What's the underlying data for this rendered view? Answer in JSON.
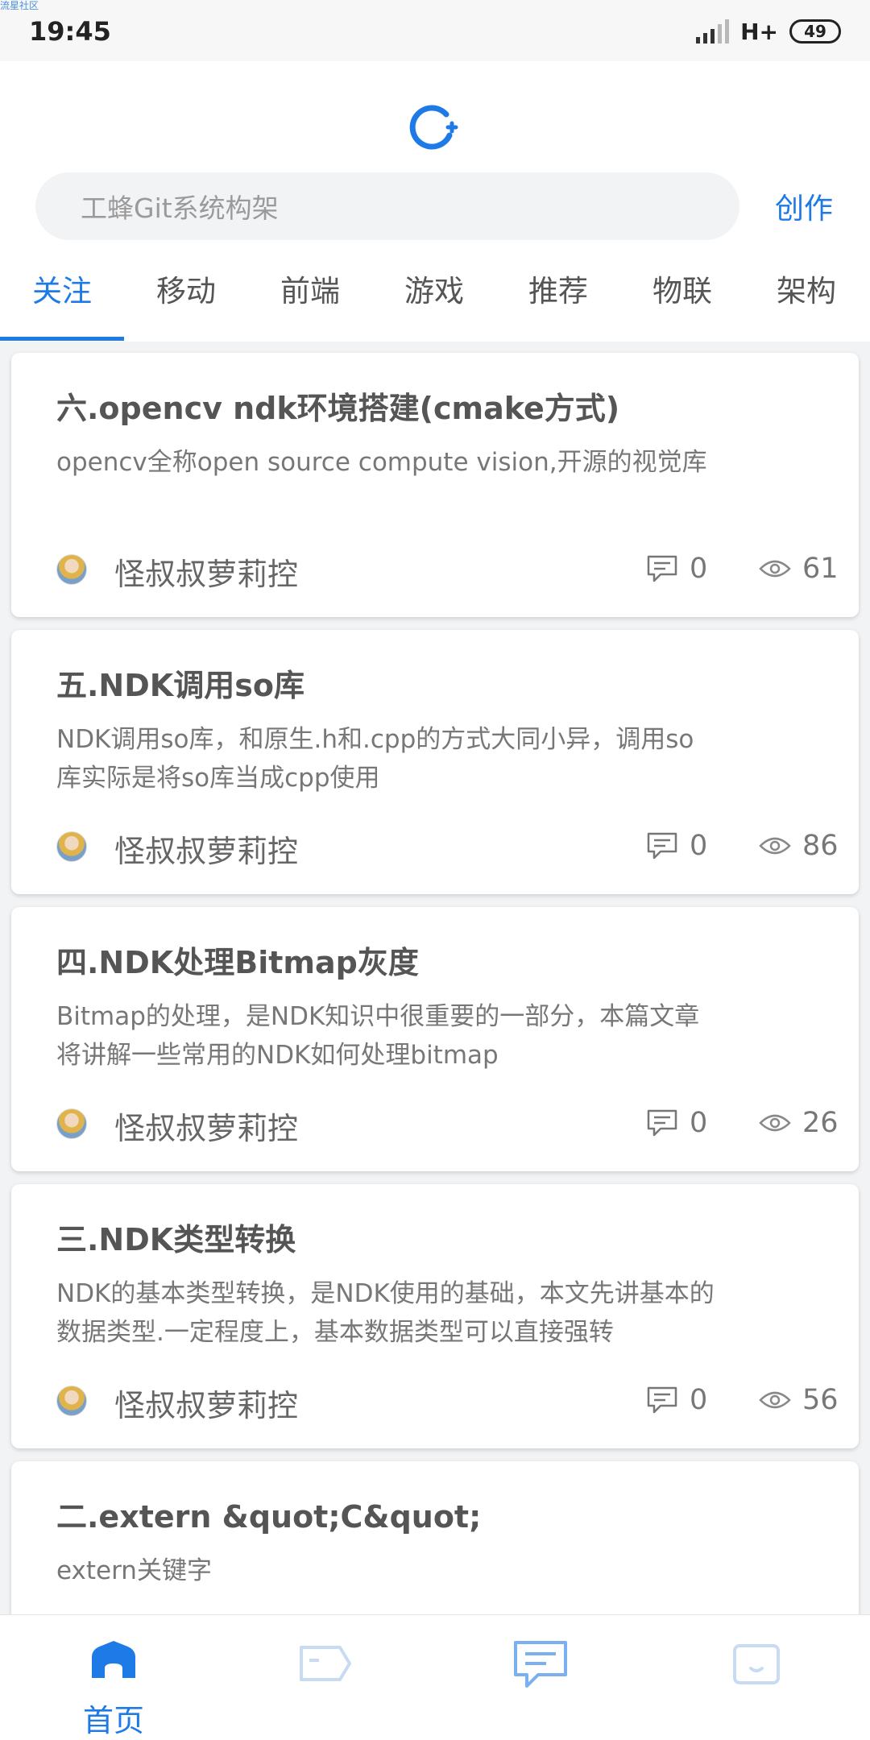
{
  "status_bar": {
    "tiny_label": "流星社区",
    "time": "19:45",
    "network": "H+",
    "battery": "49"
  },
  "header": {
    "search_placeholder": "工蜂Git系统构架",
    "create_label": "创作",
    "tabs": [
      {
        "label": "关注",
        "active": true
      },
      {
        "label": "移动"
      },
      {
        "label": "前端"
      },
      {
        "label": "游戏"
      },
      {
        "label": "推荐"
      },
      {
        "label": "物联"
      },
      {
        "label": "架构"
      }
    ]
  },
  "feed": {
    "articles": [
      {
        "title": "六.opencv ndk环境搭建(cmake方式)",
        "summary": "opencv全称open source compute vision,开源的视觉库",
        "author": "怪叔叔萝莉控",
        "comments": "0",
        "views": "61"
      },
      {
        "title": "五.NDK调用so库",
        "summary": "NDK调用so库，和原生.h和.cpp的方式大同小异，调用so库实际是将so库当成cpp使用",
        "author": "怪叔叔萝莉控",
        "comments": "0",
        "views": "86"
      },
      {
        "title": "四.NDK处理Bitmap灰度",
        "summary": "Bitmap的处理，是NDK知识中很重要的一部分，本篇文章将讲解一些常用的NDK如何处理bitmap",
        "author": "怪叔叔萝莉控",
        "comments": "0",
        "views": "26"
      },
      {
        "title": "三.NDK类型转换",
        "summary": "NDK的基本类型转换，是NDK使用的基础，本文先讲基本的数据类型.一定程度上，基本数据类型可以直接强转",
        "author": "怪叔叔萝莉控",
        "comments": "0",
        "views": "56"
      },
      {
        "title": "二.extern &quot;C&quot;",
        "summary": "extern关键字",
        "author": "",
        "comments": "",
        "views": ""
      }
    ]
  },
  "bottom_nav": {
    "home_label": "首页",
    "accent_color": "#1e7ae6"
  }
}
